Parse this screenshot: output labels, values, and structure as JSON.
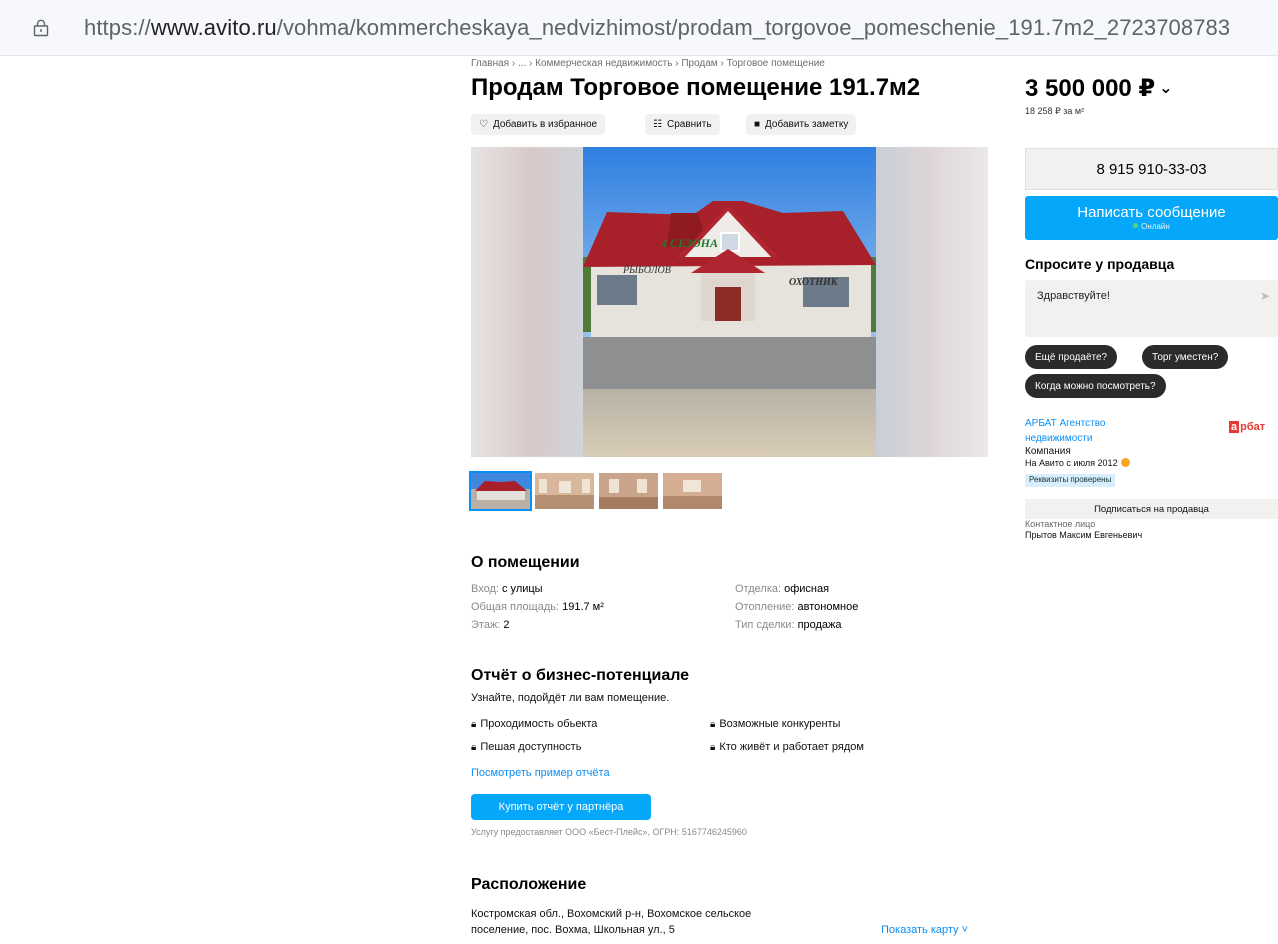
{
  "browser": {
    "url_prefix": "https://",
    "url_domain": "www.avito.ru",
    "url_path": "/vohma/kommercheskaya_nedvizhimost/prodam_torgovoe_pomeschenie_191.7m2_2723708783"
  },
  "breadcrumb": "Главная › ... › Коммерческая недвижимость › Продам › Торговое помещение",
  "title": "Продам Торговое помещение 191.7м2",
  "price": "3 500 000 ₽",
  "price_chevron": "⌄",
  "price_per_sqm": "18 258 ₽ за м²",
  "actions": {
    "favorite": "Добавить в избранное",
    "compare": "Сравнить",
    "note": "Добавить заметку"
  },
  "photo_sign": {
    "line1": "4 СЕЗОНА",
    "line2": "РЫБОЛОВ",
    "line3": "ОХОТНИК"
  },
  "seller_panel": {
    "phone": "8 915 910-33-03",
    "message_button": "Написать сообщение",
    "online_status": "Онлайн",
    "ask_heading": "Спросите у продавца",
    "ask_text": "Здравствуйте!",
    "send_icon": "send-arrow-icon",
    "quick_questions": [
      "Ещё продаёте?",
      "Торг уместен?",
      "Когда можно посмотреть?"
    ],
    "agency_line1": "АРБАТ Агентство",
    "agency_line2": "недвижимости",
    "agency_logo_first": "а",
    "agency_logo_rest": "рбат",
    "seller_type": "Компания",
    "on_avito_since": "На Авито с июля 2012",
    "verified_badge": "Реквизиты проверены",
    "subscribe": "Подписаться на продавца",
    "contact_label": "Контактное лицо",
    "contact_name": "Прытов Максим Евгеньевич"
  },
  "about": {
    "heading": "О помещении",
    "left": [
      {
        "key": "Вход: ",
        "value": "с улицы"
      },
      {
        "key": "Общая площадь: ",
        "value": "191.7 м²"
      },
      {
        "key": "Этаж: ",
        "value": "2"
      }
    ],
    "right": [
      {
        "key": "Отделка: ",
        "value": "офисная"
      },
      {
        "key": "Отопление: ",
        "value": "автономное"
      },
      {
        "key": "Тип сделки: ",
        "value": "продажа"
      }
    ]
  },
  "report": {
    "heading": "Отчёт о бизнес-потенциале",
    "subtitle": "Узнайте, подойдёт ли вам помещение.",
    "features": [
      "Проходимость обьекта",
      "Возможные конкуренты",
      "Пешая доступность",
      "Кто живёт и работает рядом"
    ],
    "sample_link": "Посмотреть пример отчёта",
    "buy_button": "Купить отчёт у партнёра",
    "provider": "Услугу предоставляет ООО «Бест-Плейс», ОГРН: 5167746245960"
  },
  "location": {
    "heading": "Расположение",
    "address_line1": "Костромская обл., Вохомский р-н, Вохомское сельское",
    "address_line2": "поселение, пос. Вохма, Школьная ул., 5",
    "map_link": "Показать карту ˅"
  },
  "colors": {
    "accent": "#04a7f9",
    "link": "#0a8ff5",
    "chip_bg": "#f2f1f0",
    "dark_pill": "#2b2b2b"
  }
}
